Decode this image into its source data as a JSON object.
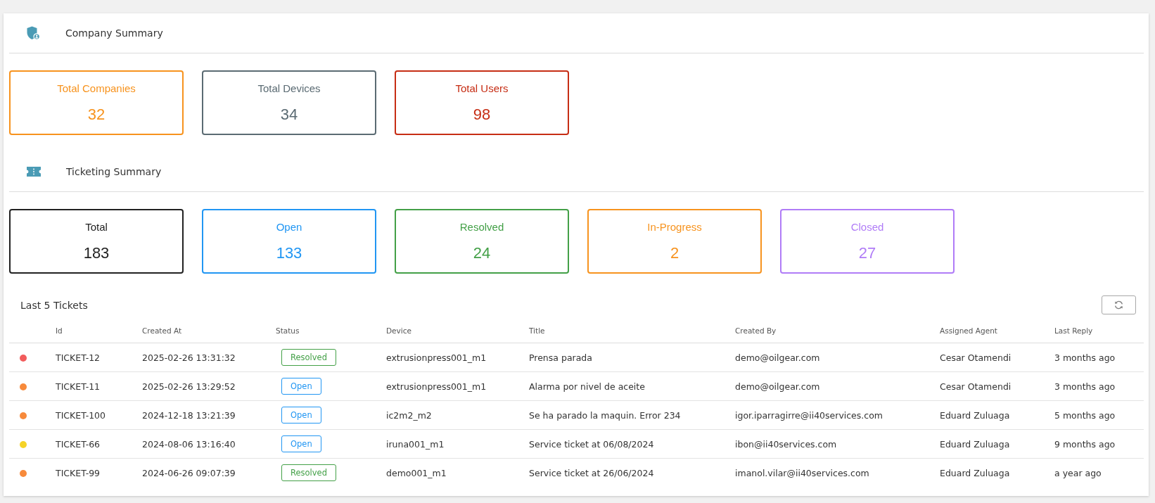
{
  "sections": [
    {
      "kind": "company",
      "title": "Company Summary",
      "cards": [
        {
          "label": "Total Companies",
          "value": "32",
          "color": "#f7931e"
        },
        {
          "label": "Total Devices",
          "value": "34",
          "color": "#5b6b73"
        },
        {
          "label": "Total Users",
          "value": "98",
          "color": "#c62d14"
        }
      ]
    },
    {
      "kind": "ticketing",
      "title": "Ticketing Summary",
      "cards": [
        {
          "label": "Total",
          "value": "183",
          "color": "#222222"
        },
        {
          "label": "Open",
          "value": "133",
          "color": "#2196f3"
        },
        {
          "label": "Resolved",
          "value": "24",
          "color": "#43a047"
        },
        {
          "label": "In-Progress",
          "value": "2",
          "color": "#f7931e"
        },
        {
          "label": "Closed",
          "value": "27",
          "color": "#b07cf7"
        }
      ]
    }
  ],
  "tickets": {
    "title": "Last 5 Tickets",
    "columns": [
      "Id",
      "Created At",
      "Status",
      "Device",
      "Title",
      "Created By",
      "Assigned Agent",
      "Last Reply"
    ],
    "rows": [
      {
        "color": "#f25c5c",
        "id": "TICKET-12",
        "created_at": "2025-02-26 13:31:32",
        "status": {
          "label": "Resolved",
          "color": "#43a047"
        },
        "device": "extrusionpress001_m1",
        "title": "Prensa parada",
        "created_by": "demo@oilgear.com",
        "agent": "Cesar Otamendi",
        "last_reply": "3 months ago"
      },
      {
        "color": "#f78a3b",
        "id": "TICKET-11",
        "created_at": "2025-02-26 13:29:52",
        "status": {
          "label": "Open",
          "color": "#2196f3"
        },
        "device": "extrusionpress001_m1",
        "title": "Alarma por nivel de aceite",
        "created_by": "demo@oilgear.com",
        "agent": "Cesar Otamendi",
        "last_reply": "3 months ago"
      },
      {
        "color": "#f78a3b",
        "id": "TICKET-100",
        "created_at": "2024-12-18 13:21:39",
        "status": {
          "label": "Open",
          "color": "#2196f3"
        },
        "device": "ic2m2_m2",
        "title": "Se ha parado la maquin. Error 234",
        "created_by": "igor.iparragirre@ii40services.com",
        "agent": "Eduard Zuluaga",
        "last_reply": "5 months ago"
      },
      {
        "color": "#f5d327",
        "id": "TICKET-66",
        "created_at": "2024-08-06 13:16:40",
        "status": {
          "label": "Open",
          "color": "#2196f3"
        },
        "device": "iruna001_m1",
        "title": "Service ticket at 06/08/2024",
        "created_by": "ibon@ii40services.com",
        "agent": "Eduard Zuluaga",
        "last_reply": "9 months ago"
      },
      {
        "color": "#f78a3b",
        "id": "TICKET-99",
        "created_at": "2024-06-26 09:07:39",
        "status": {
          "label": "Resolved",
          "color": "#43a047"
        },
        "device": "demo001_m1",
        "title": "Service ticket at 26/06/2024",
        "created_by": "imanol.vilar@ii40services.com",
        "agent": "Eduard Zuluaga",
        "last_reply": "a year ago"
      }
    ]
  }
}
